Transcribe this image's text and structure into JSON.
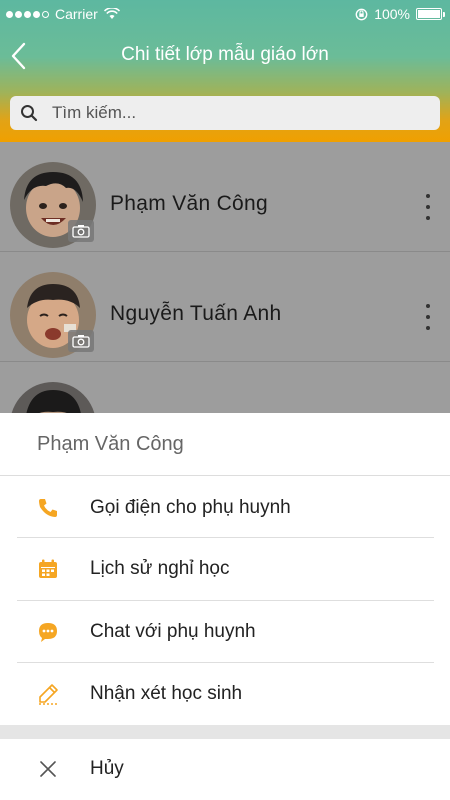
{
  "status_bar": {
    "carrier": "Carrier",
    "time": "",
    "battery": "100%"
  },
  "nav": {
    "title": "Chi tiết lớp mẫu giáo lớn"
  },
  "search": {
    "placeholder": "Tìm kiếm..."
  },
  "students": [
    {
      "name": "Phạm Văn Công"
    },
    {
      "name": "Nguyễn Tuấn Anh"
    },
    {
      "name": ""
    }
  ],
  "action_sheet": {
    "title": "Phạm Văn Công",
    "actions": [
      {
        "label": "Gọi điện cho phụ huynh",
        "icon": "phone-icon"
      },
      {
        "label": "Lịch sử nghỉ học",
        "icon": "calendar-icon"
      },
      {
        "label": "Chat với phụ huynh",
        "icon": "chat-icon"
      },
      {
        "label": "Nhận xét học sinh",
        "icon": "pencil-icon"
      }
    ],
    "cancel": {
      "label": "Hủy",
      "icon": "close-icon"
    }
  },
  "colors": {
    "accent": "#f5a623",
    "header_top": "#5db8a0",
    "header_bottom": "#f0a000"
  }
}
